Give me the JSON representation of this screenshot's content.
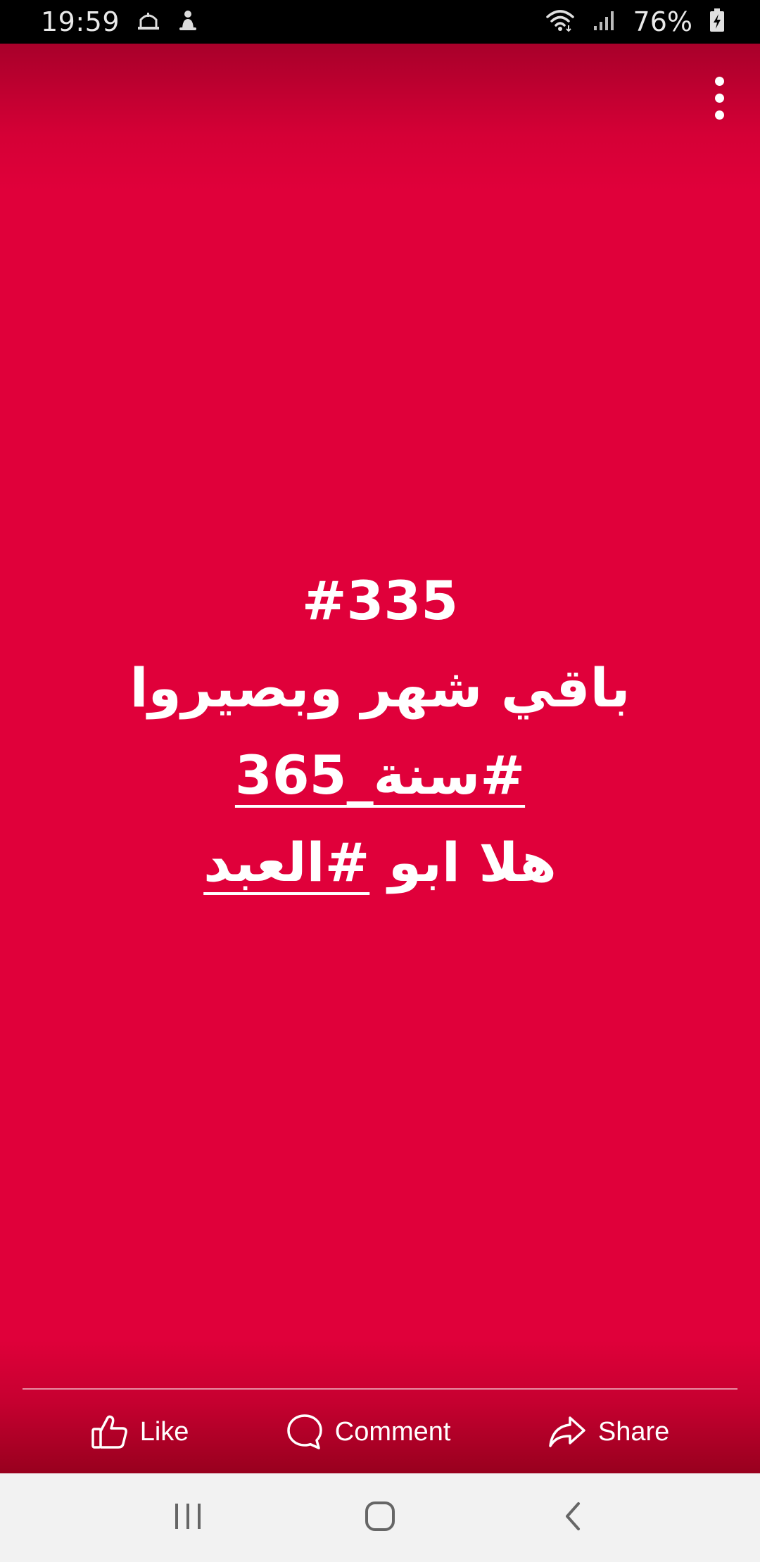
{
  "status_bar": {
    "time": "19:59",
    "battery_percent": "76%",
    "left_icons": [
      "mosque-notification-icon",
      "notification-icon"
    ],
    "right_icons": [
      "wifi-icon",
      "signal-icon",
      "battery-charging-icon"
    ]
  },
  "post": {
    "background_color": "#e0003a",
    "lines": [
      {
        "text": "#335"
      },
      {
        "text": "باقي شهر وبصيروا"
      },
      {
        "hashtag": "#سنة_365"
      },
      {
        "prefix": "هلا ابو ",
        "hashtag": "#العبد"
      }
    ],
    "menu_icon": "more-vertical-icon"
  },
  "actions": {
    "like_label": "Like",
    "comment_label": "Comment",
    "share_label": "Share"
  },
  "nav_bar": {
    "icons": [
      "recent-apps-icon",
      "home-icon",
      "back-icon"
    ]
  }
}
